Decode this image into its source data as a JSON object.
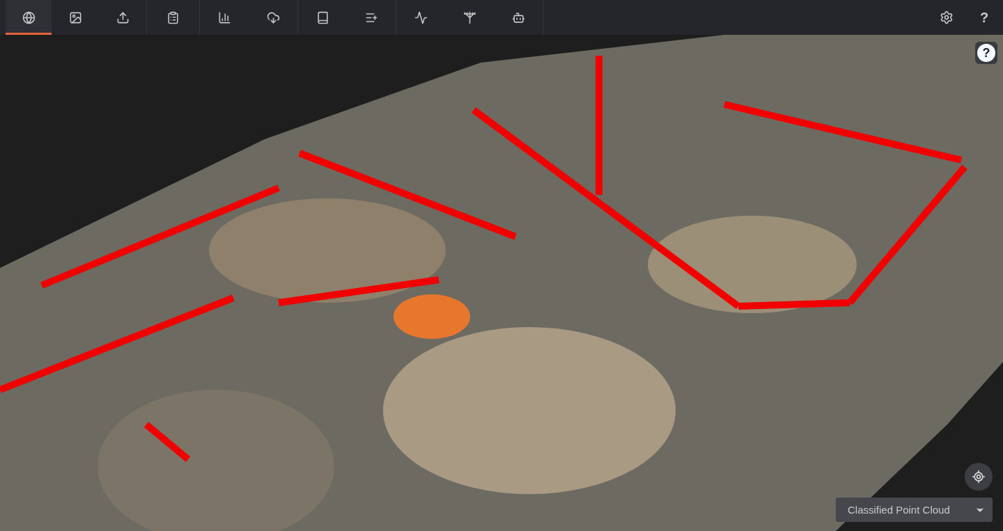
{
  "toolbar": {
    "groups": [
      {
        "tools": [
          {
            "selected": true
          },
          {
            "selected": false
          },
          {
            "selected": false
          }
        ]
      },
      {
        "tools": [
          {
            "selected": false
          }
        ]
      },
      {
        "tools": [
          {
            "selected": false
          },
          {
            "selected": false
          }
        ]
      },
      {
        "tools": [
          {
            "selected": false
          },
          {
            "selected": false
          }
        ]
      },
      {
        "tools": [
          {
            "selected": false
          },
          {
            "selected": false
          },
          {
            "selected": false
          }
        ]
      }
    ],
    "help_label": "?"
  },
  "viewer": {
    "help_label": "?",
    "layer_select": {
      "value": "Classified Point Cloud"
    }
  }
}
